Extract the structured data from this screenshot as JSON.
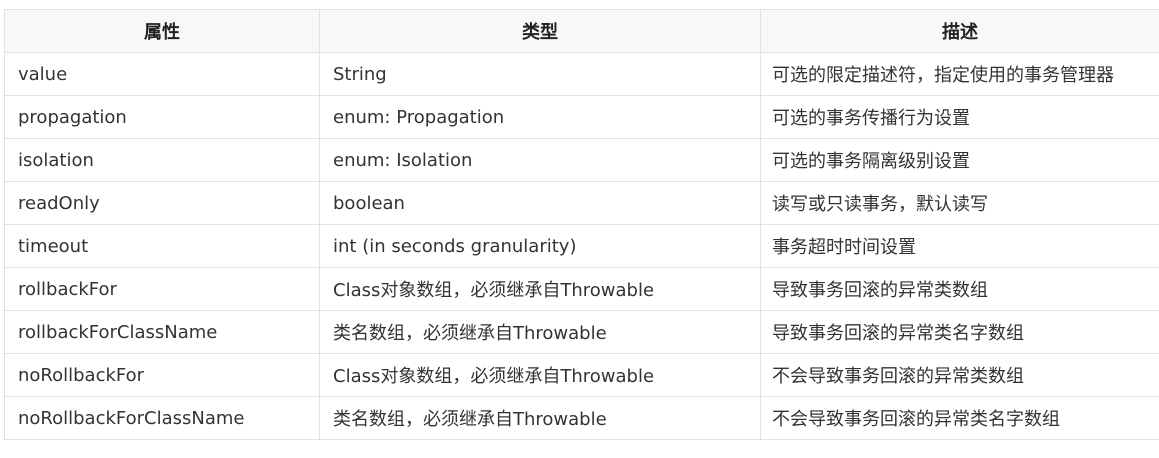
{
  "table": {
    "headers": [
      "属性",
      "类型",
      "描述"
    ],
    "rows": [
      [
        "value",
        "String",
        "可选的限定描述符，指定使用的事务管理器"
      ],
      [
        "propagation",
        "enum: Propagation",
        "可选的事务传播行为设置"
      ],
      [
        "isolation",
        "enum: Isolation",
        "可选的事务隔离级别设置"
      ],
      [
        "readOnly",
        "boolean",
        "读写或只读事务，默认读写"
      ],
      [
        "timeout",
        "int (in seconds granularity)",
        "事务超时时间设置"
      ],
      [
        "rollbackFor",
        "Class对象数组，必须继承自Throwable",
        "导致事务回滚的异常类数组"
      ],
      [
        "rollbackForClassName",
        "类名数组，必须继承自Throwable",
        "导致事务回滚的异常类名字数组"
      ],
      [
        "noRollbackFor",
        "Class对象数组，必须继承自Throwable",
        "不会导致事务回滚的异常类数组"
      ],
      [
        "noRollbackForClassName",
        "类名数组，必须继承自Throwable",
        "不会导致事务回滚的异常类名字数组"
      ]
    ]
  },
  "colors": {
    "header_bg": "#f6f8fa",
    "border": "#dfe2e5",
    "text": "#333333"
  }
}
